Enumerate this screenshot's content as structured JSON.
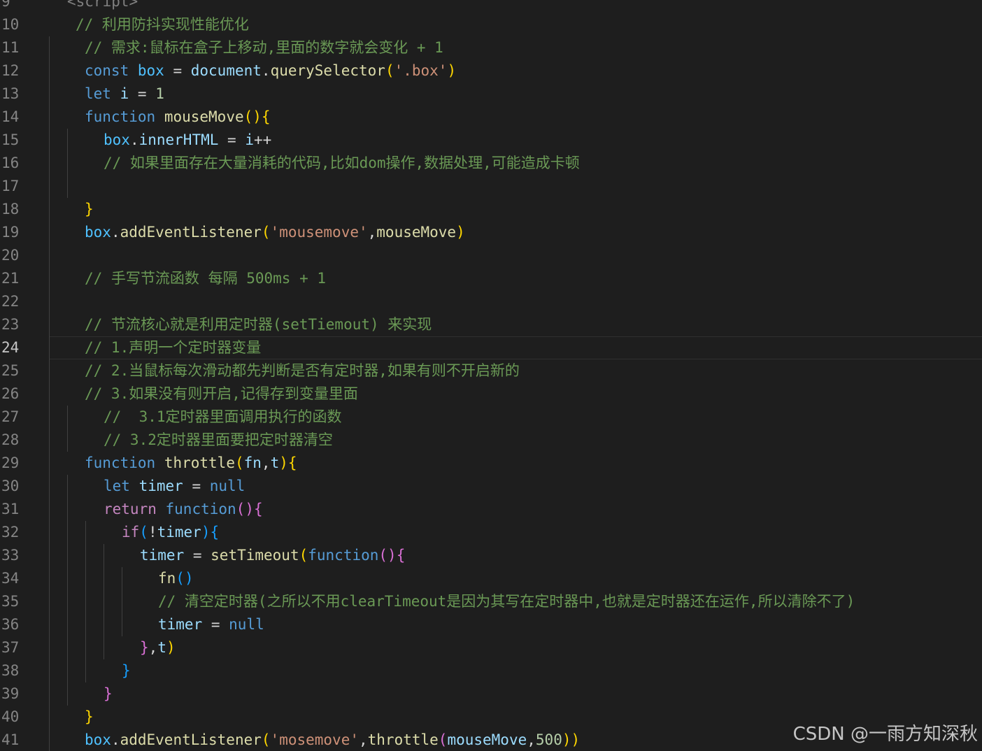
{
  "colors": {
    "background": "#1e1e1e",
    "comment": "#6a9955",
    "keyword": "#569cd6",
    "control": "#c586c0",
    "function": "#dcdcaa",
    "variable": "#9cdcfe",
    "string": "#ce9178",
    "number": "#b5cea8",
    "bracket1": "#ffd700",
    "bracket2": "#da70d6",
    "bracket3": "#179fff",
    "punct": "#d4d4d4",
    "lineNumber": "#858585"
  },
  "active_line": 24,
  "watermark": "CSDN @一雨方知深秋",
  "lines": [
    {
      "n": "9",
      "indent": 1,
      "tokens": [
        [
          "<script>",
          "#808080"
        ]
      ]
    },
    {
      "n": "10",
      "indent": 1,
      "tokens": [
        [
          "// 利用防抖实现性能优化",
          "#6a9955"
        ]
      ]
    },
    {
      "n": "11",
      "indent": 2,
      "tokens": [
        [
          "// 需求:鼠标在盒子上移动,里面的数字就会变化 + 1",
          "#6a9955"
        ]
      ]
    },
    {
      "n": "12",
      "indent": 2,
      "tokens": [
        [
          "const",
          "#569cd6"
        ],
        [
          " ",
          "#d4d4d4"
        ],
        [
          "box",
          "#4fc1ff"
        ],
        [
          " = ",
          "#d4d4d4"
        ],
        [
          "document",
          "#9cdcfe"
        ],
        [
          ".",
          "#d4d4d4"
        ],
        [
          "querySelector",
          "#dcdcaa"
        ],
        [
          "(",
          "#ffd700"
        ],
        [
          "'.box'",
          "#ce9178"
        ],
        [
          ")",
          "#ffd700"
        ]
      ]
    },
    {
      "n": "13",
      "indent": 2,
      "tokens": [
        [
          "let",
          "#569cd6"
        ],
        [
          " ",
          "#d4d4d4"
        ],
        [
          "i",
          "#9cdcfe"
        ],
        [
          " = ",
          "#d4d4d4"
        ],
        [
          "1",
          "#b5cea8"
        ]
      ]
    },
    {
      "n": "14",
      "indent": 2,
      "tokens": [
        [
          "function",
          "#569cd6"
        ],
        [
          " ",
          "#d4d4d4"
        ],
        [
          "mouseMove",
          "#dcdcaa"
        ],
        [
          "(){",
          "#ffd700"
        ]
      ]
    },
    {
      "n": "15",
      "indent": 3,
      "tokens": [
        [
          "box",
          "#4fc1ff"
        ],
        [
          ".",
          "#d4d4d4"
        ],
        [
          "innerHTML",
          "#9cdcfe"
        ],
        [
          " = ",
          "#d4d4d4"
        ],
        [
          "i",
          "#9cdcfe"
        ],
        [
          "++",
          "#d4d4d4"
        ]
      ]
    },
    {
      "n": "16",
      "indent": 3,
      "tokens": [
        [
          "// 如果里面存在大量消耗的代码,比如dom操作,数据处理,可能造成卡顿",
          "#6a9955"
        ]
      ]
    },
    {
      "n": "17",
      "indent": 3,
      "tokens": []
    },
    {
      "n": "18",
      "indent": 2,
      "tokens": [
        [
          "}",
          "#ffd700"
        ]
      ]
    },
    {
      "n": "19",
      "indent": 2,
      "tokens": [
        [
          "box",
          "#4fc1ff"
        ],
        [
          ".",
          "#d4d4d4"
        ],
        [
          "addEventListener",
          "#dcdcaa"
        ],
        [
          "(",
          "#ffd700"
        ],
        [
          "'mousemove'",
          "#ce9178"
        ],
        [
          ",",
          "#d4d4d4"
        ],
        [
          "mouseMove",
          "#dcdcaa"
        ],
        [
          ")",
          "#ffd700"
        ]
      ]
    },
    {
      "n": "20",
      "indent": 2,
      "tokens": []
    },
    {
      "n": "21",
      "indent": 2,
      "tokens": [
        [
          "// 手写节流函数 每隔 500ms + 1",
          "#6a9955"
        ]
      ]
    },
    {
      "n": "22",
      "indent": 2,
      "tokens": []
    },
    {
      "n": "23",
      "indent": 2,
      "tokens": [
        [
          "// 节流核心就是利用定时器(setTiemout) 来实现",
          "#6a9955"
        ]
      ]
    },
    {
      "n": "24",
      "indent": 2,
      "tokens": [
        [
          "// 1.声明一个定时器变量",
          "#6a9955"
        ]
      ]
    },
    {
      "n": "25",
      "indent": 2,
      "tokens": [
        [
          "// 2.当鼠标每次滑动都先判断是否有定时器,如果有则不开启新的",
          "#6a9955"
        ]
      ]
    },
    {
      "n": "26",
      "indent": 2,
      "tokens": [
        [
          "// 3.如果没有则开启,记得存到变量里面",
          "#6a9955"
        ]
      ]
    },
    {
      "n": "27",
      "indent": 3,
      "tokens": [
        [
          "//  3.1定时器里面调用执行的函数",
          "#6a9955"
        ]
      ]
    },
    {
      "n": "28",
      "indent": 3,
      "tokens": [
        [
          "// 3.2定时器里面要把定时器清空",
          "#6a9955"
        ]
      ]
    },
    {
      "n": "29",
      "indent": 2,
      "tokens": [
        [
          "function",
          "#569cd6"
        ],
        [
          " ",
          "#d4d4d4"
        ],
        [
          "throttle",
          "#dcdcaa"
        ],
        [
          "(",
          "#ffd700"
        ],
        [
          "fn",
          "#9cdcfe"
        ],
        [
          ",",
          "#d4d4d4"
        ],
        [
          "t",
          "#9cdcfe"
        ],
        [
          "){",
          "#ffd700"
        ]
      ]
    },
    {
      "n": "30",
      "indent": 3,
      "tokens": [
        [
          "let",
          "#569cd6"
        ],
        [
          " ",
          "#d4d4d4"
        ],
        [
          "timer",
          "#9cdcfe"
        ],
        [
          " = ",
          "#d4d4d4"
        ],
        [
          "null",
          "#569cd6"
        ]
      ]
    },
    {
      "n": "31",
      "indent": 3,
      "tokens": [
        [
          "return",
          "#c586c0"
        ],
        [
          " ",
          "#d4d4d4"
        ],
        [
          "function",
          "#569cd6"
        ],
        [
          "(){",
          "#da70d6"
        ]
      ]
    },
    {
      "n": "32",
      "indent": 4,
      "tokens": [
        [
          "if",
          "#c586c0"
        ],
        [
          "(",
          "#179fff"
        ],
        [
          "!",
          "#d4d4d4"
        ],
        [
          "timer",
          "#9cdcfe"
        ],
        [
          "){",
          "#179fff"
        ]
      ]
    },
    {
      "n": "33",
      "indent": 5,
      "tokens": [
        [
          "timer",
          "#9cdcfe"
        ],
        [
          " = ",
          "#d4d4d4"
        ],
        [
          "setTimeout",
          "#dcdcaa"
        ],
        [
          "(",
          "#ffd700"
        ],
        [
          "function",
          "#569cd6"
        ],
        [
          "(){",
          "#da70d6"
        ]
      ]
    },
    {
      "n": "34",
      "indent": 6,
      "tokens": [
        [
          "fn",
          "#dcdcaa"
        ],
        [
          "()",
          "#179fff"
        ]
      ]
    },
    {
      "n": "35",
      "indent": 6,
      "tokens": [
        [
          "// 清空定时器(之所以不用clearTimeout是因为其写在定时器中,也就是定时器还在运作,所以清除不了)",
          "#6a9955"
        ]
      ]
    },
    {
      "n": "36",
      "indent": 6,
      "tokens": [
        [
          "timer",
          "#9cdcfe"
        ],
        [
          " = ",
          "#d4d4d4"
        ],
        [
          "null",
          "#569cd6"
        ]
      ]
    },
    {
      "n": "37",
      "indent": 5,
      "tokens": [
        [
          "}",
          "#da70d6"
        ],
        [
          ",",
          "#d4d4d4"
        ],
        [
          "t",
          "#9cdcfe"
        ],
        [
          ")",
          "#ffd700"
        ]
      ]
    },
    {
      "n": "38",
      "indent": 4,
      "tokens": [
        [
          "}",
          "#179fff"
        ]
      ]
    },
    {
      "n": "39",
      "indent": 3,
      "tokens": [
        [
          "}",
          "#da70d6"
        ]
      ]
    },
    {
      "n": "40",
      "indent": 2,
      "tokens": [
        [
          "}",
          "#ffd700"
        ]
      ]
    },
    {
      "n": "41",
      "indent": 2,
      "tokens": [
        [
          "box",
          "#4fc1ff"
        ],
        [
          ".",
          "#d4d4d4"
        ],
        [
          "addEventListener",
          "#dcdcaa"
        ],
        [
          "(",
          "#ffd700"
        ],
        [
          "'mosemove'",
          "#ce9178"
        ],
        [
          ",",
          "#d4d4d4"
        ],
        [
          "throttle",
          "#dcdcaa"
        ],
        [
          "(",
          "#da70d6"
        ],
        [
          "mouseMove",
          "#9cdcfe"
        ],
        [
          ",",
          "#d4d4d4"
        ],
        [
          "500",
          "#b5cea8"
        ],
        [
          "))",
          "#ffd700"
        ]
      ]
    }
  ]
}
